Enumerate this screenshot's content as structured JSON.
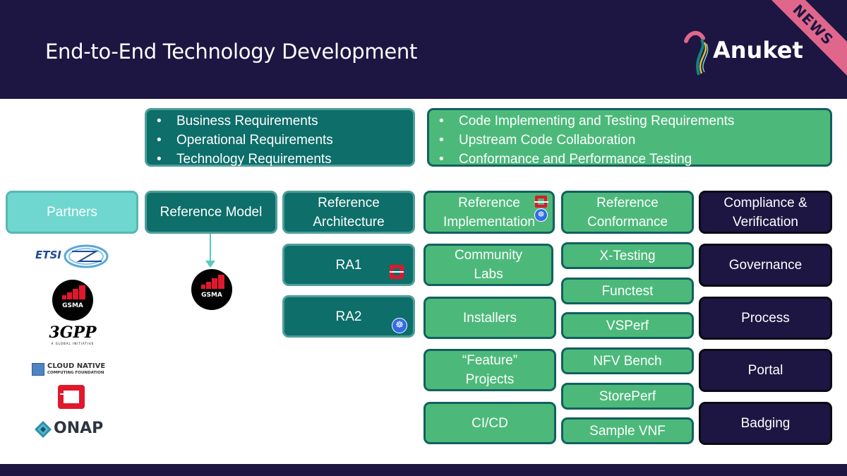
{
  "header": {
    "title": "End-to-End Technology Development",
    "logo_text": "Anuket",
    "news_badge": "NEWS",
    "colors": {
      "background": "#1d1642",
      "news": "#e0678b"
    }
  },
  "requirements": {
    "model": [
      "Business Requirements",
      "Operational Requirements",
      "Technology Requirements"
    ],
    "implementation": [
      "Code Implementing and Testing Requirements",
      "Upstream Code Collaboration",
      "Conformance and Performance Testing"
    ]
  },
  "columns": {
    "partners": {
      "label": "Partners",
      "logos": [
        "ETSI",
        "GSMA",
        "3GPP",
        "CLOUD NATIVE",
        "COMPUTING FOUNDATION",
        "OpenStack",
        "ONAP"
      ]
    },
    "reference_model": {
      "label": "Reference Model",
      "logo": "GSMA"
    },
    "reference_architecture": {
      "label": "Reference Architecture",
      "items": [
        "RA1",
        "RA2"
      ]
    },
    "reference_implementation": {
      "label": "Reference Implementation",
      "items": [
        "Community Labs",
        "Installers",
        "“Feature” Projects",
        "CI/CD"
      ]
    },
    "reference_conformance": {
      "label": "Reference Conformance",
      "items": [
        "X-Testing",
        "Functest",
        "VSPerf",
        "NFV Bench",
        "StorePerf",
        "Sample VNF"
      ]
    },
    "compliance": {
      "label": "Compliance & Verification",
      "items": [
        "Governance",
        "Process",
        "Portal",
        "Badging"
      ]
    }
  },
  "colors": {
    "teal": "#0d6e6a",
    "light_teal": "#6fd6d0",
    "green": "#4cb97a",
    "navy": "#1d1642"
  }
}
